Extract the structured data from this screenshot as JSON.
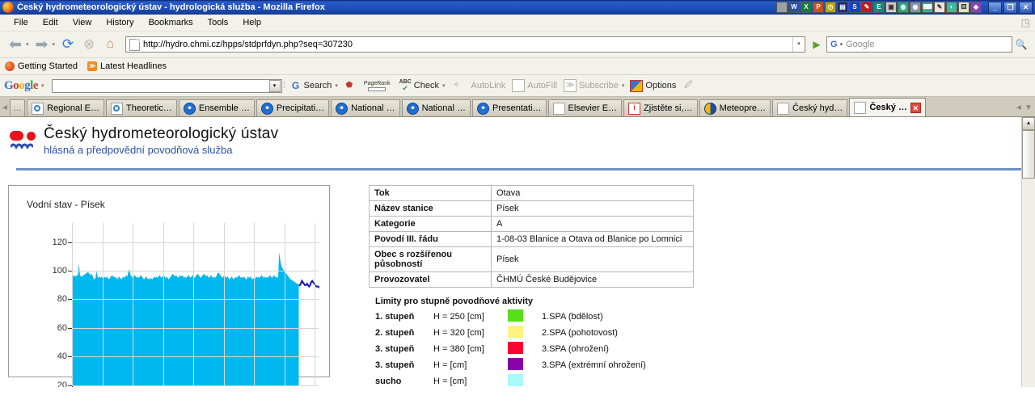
{
  "window": {
    "title": "Český hydrometeorologický ústav - hydrologická služba - Mozilla Firefox",
    "minimize": "_",
    "restore": "❐",
    "close": "✕"
  },
  "menu": {
    "items": [
      "File",
      "Edit",
      "View",
      "History",
      "Bookmarks",
      "Tools",
      "Help"
    ]
  },
  "nav": {
    "back": "back-arrow",
    "forward": "forward-arrow",
    "reload": "reload-icon",
    "stop": "stop-icon",
    "home": "home-icon",
    "url": "http://hydro.chmi.cz/hpps/stdprfdyn.php?seq=307230",
    "go": "go-arrow",
    "search_engine": "G",
    "search_placeholder": "Google"
  },
  "bookmarks": {
    "items": [
      "Getting Started",
      "Latest Headlines"
    ]
  },
  "google_toolbar": {
    "logo": [
      "G",
      "o",
      "o",
      "g",
      "l",
      "e"
    ],
    "input_value": "",
    "buttons": [
      {
        "label": "Search",
        "icon": "google-g-icon",
        "dim": false,
        "caret": true
      },
      {
        "label": "",
        "icon": "shield-icon",
        "dim": false,
        "caret": false
      },
      {
        "label": "",
        "icon": "pagerank-icon",
        "dim": false,
        "caret": false
      },
      {
        "label": "Check",
        "icon": "spellcheck-icon",
        "dim": false,
        "caret": true
      },
      {
        "label": "",
        "icon": "wand-icon",
        "dim": true,
        "caret": false
      },
      {
        "label": "AutoLink",
        "icon": "autolink-icon",
        "dim": true,
        "caret": false
      },
      {
        "label": "AutoFill",
        "icon": "autofill-icon",
        "dim": true,
        "caret": false
      },
      {
        "label": "Subscribe",
        "icon": "rss-icon",
        "dim": true,
        "caret": false
      },
      {
        "label": "Options",
        "icon": "options-icon",
        "dim": false,
        "caret": false
      },
      {
        "label": "",
        "icon": "highlighter-icon",
        "dim": true,
        "caret": false
      }
    ],
    "pagerank_label": "PageRank",
    "abc_label": "ABC"
  },
  "tabs": {
    "scroll_left": "◄",
    "scroll_right": "▼",
    "items": [
      {
        "label": "...",
        "icon": "overflow-icon",
        "active": false,
        "close": false
      },
      {
        "label": "Regional E…",
        "icon": "blue-doc-icon",
        "active": false,
        "close": false
      },
      {
        "label": "Theoretic…",
        "icon": "blue-doc-icon",
        "active": false,
        "close": false
      },
      {
        "label": "Ensemble …",
        "icon": "noaa-icon",
        "active": false,
        "close": false
      },
      {
        "label": "Precipitati…",
        "icon": "noaa-icon",
        "active": false,
        "close": false
      },
      {
        "label": "National …",
        "icon": "noaa-icon",
        "active": false,
        "close": false
      },
      {
        "label": "National …",
        "icon": "noaa-icon",
        "active": false,
        "close": false
      },
      {
        "label": "Presentati…",
        "icon": "noaa-icon",
        "active": false,
        "close": false
      },
      {
        "label": "Elsevier E…",
        "icon": "doc-icon",
        "active": false,
        "close": false
      },
      {
        "label": "Zjistěte si,…",
        "icon": "info-icon",
        "active": false,
        "close": false
      },
      {
        "label": "Meteopre…",
        "icon": "meteo-icon",
        "active": false,
        "close": false
      },
      {
        "label": "Český hyd…",
        "icon": "doc-icon",
        "active": false,
        "close": false
      },
      {
        "label": "Český …",
        "icon": "doc-icon",
        "active": true,
        "close": true
      }
    ],
    "close_glyph": "✕"
  },
  "page": {
    "org_title": "Český hydrometeorologický ústav",
    "org_subtitle": "hlásná a předpovědní povodňová služba",
    "info_table": {
      "rows": [
        {
          "key": "Tok",
          "value": "Otava"
        },
        {
          "key": "Název stanice",
          "value": "Písek"
        },
        {
          "key": "Kategorie",
          "value": "A"
        },
        {
          "key": "Povodí III. řádu",
          "value": "1-08-03 Blanice a Otava od Blanice po Lomnici"
        },
        {
          "key": "Obec s rozšířenou působností",
          "value": "Písek"
        },
        {
          "key": "Provozovatel",
          "value": "ČHMÚ České Budějovice"
        }
      ]
    },
    "limits": {
      "title": "Limity pro stupně povodňové aktivity",
      "rows": [
        {
          "stage": "1. stupeň",
          "h": "H = 250 [cm]",
          "color": "#55E017",
          "desc": "1.SPA (bdělost)"
        },
        {
          "stage": "2. stupeň",
          "h": "H = 320 [cm]",
          "color": "#FFF380",
          "desc": "2.SPA (pohotovost)"
        },
        {
          "stage": "3. stupeň",
          "h": "H = 380 [cm]",
          "color": "#FF0033",
          "desc": "3.SPA (ohrožení)"
        },
        {
          "stage": "3. stupeň",
          "h": "H = [cm]",
          "color": "#8A00AA",
          "desc": "3.SPA (extrémní ohrožení)"
        },
        {
          "stage": "sucho",
          "h": "H = [cm]",
          "color": "#A8FAFA",
          "desc": ""
        }
      ]
    }
  },
  "chart_data": {
    "type": "area",
    "title": "Vodní stav - Písek",
    "xlabel": "",
    "ylabel": "",
    "ylim": [
      20,
      130
    ],
    "yticks": [
      120,
      100,
      80,
      60,
      40,
      20
    ],
    "grid": true,
    "colors": {
      "observed_fill": "#00B8F0",
      "forecast_line": "#1515B0"
    },
    "series": [
      {
        "name": "observed",
        "type": "area",
        "values": [
          97,
          96,
          97,
          96,
          97,
          97,
          105,
          97,
          96,
          96,
          97,
          97,
          98,
          98,
          99,
          99,
          98,
          97,
          98,
          97,
          95,
          94,
          95,
          100,
          96,
          95,
          96,
          95,
          96,
          95,
          95,
          96,
          95,
          96,
          95,
          94,
          95,
          96,
          97,
          96,
          96,
          95,
          96,
          94,
          95,
          96,
          95,
          94,
          95,
          96,
          95,
          96,
          97,
          96,
          100,
          101,
          97,
          96,
          95,
          96,
          97,
          96,
          95,
          96,
          95,
          96,
          97,
          96,
          95,
          94,
          95,
          96,
          95,
          94,
          95,
          94,
          95,
          94,
          95,
          96,
          95,
          96,
          95,
          96,
          97,
          96,
          95,
          96,
          97,
          96,
          95,
          96,
          95,
          94,
          95,
          96,
          97,
          98,
          97,
          96,
          97,
          96,
          95,
          96,
          97,
          96,
          97,
          96,
          95,
          96,
          95,
          96,
          97,
          96,
          95,
          96,
          97,
          96,
          95,
          96,
          97,
          98,
          97,
          96,
          95,
          96,
          97,
          98,
          97,
          96,
          97,
          96,
          95,
          96,
          97,
          96,
          95,
          96,
          95,
          96,
          98,
          99,
          98,
          97,
          96,
          95,
          96,
          97,
          96,
          95,
          96,
          95,
          94,
          95,
          96,
          95,
          94,
          95,
          96,
          95,
          96,
          97,
          96,
          95,
          96,
          95,
          96,
          95,
          94,
          95,
          96,
          95,
          96,
          95,
          94,
          95,
          94,
          95,
          96,
          95,
          96,
          95,
          96,
          97,
          96,
          95,
          96,
          95,
          96,
          95,
          96,
          97,
          96,
          95,
          96,
          97,
          96,
          95,
          96,
          95,
          113,
          108,
          104,
          102,
          101,
          100,
          99,
          98,
          97,
          96,
          95,
          94,
          94,
          93,
          93,
          92,
          92,
          91,
          91,
          90
        ]
      },
      {
        "name": "forecast",
        "type": "line",
        "values": [
          90,
          91,
          93,
          92,
          91,
          90,
          90,
          91,
          90,
          89,
          90,
          92,
          93,
          92,
          91,
          90,
          89,
          89,
          89,
          88
        ]
      }
    ]
  }
}
